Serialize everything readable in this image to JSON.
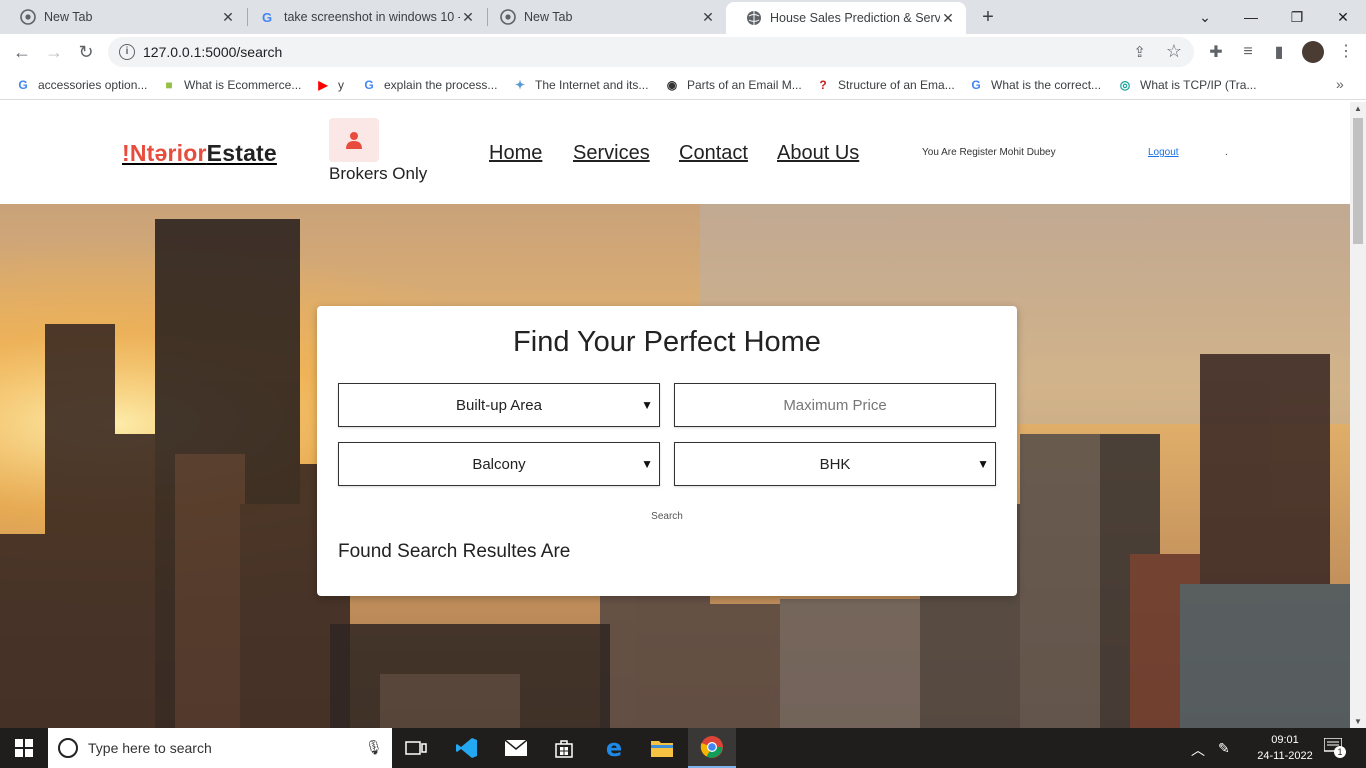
{
  "browser": {
    "tabs": [
      {
        "title": "New Tab"
      },
      {
        "title": "take screenshot in windows 10 -"
      },
      {
        "title": "New Tab"
      },
      {
        "title": "House Sales Prediction & Service"
      }
    ],
    "new_tab": "+",
    "address": "127.0.0.1:5000/search",
    "bookmarks": [
      {
        "label": "accessories option..."
      },
      {
        "label": "What is Ecommerce..."
      },
      {
        "label": "y"
      },
      {
        "label": "explain the process..."
      },
      {
        "label": "The Internet and its..."
      },
      {
        "label": "Parts of an Email M..."
      },
      {
        "label": "Structure of an Ema..."
      },
      {
        "label": "What is the correct..."
      },
      {
        "label": "What is TCP/IP (Tra..."
      }
    ],
    "bookmarks_more": "»"
  },
  "site": {
    "logo_part1": "!Ntərior",
    "logo_part2": "Estate",
    "broker_label": "Brokers Only",
    "nav": [
      "Home",
      "Services",
      "Contact",
      "About Us"
    ],
    "registered_text": "You Are Register Mohit Dubey",
    "logout": "Logout",
    "dot": "."
  },
  "search_card": {
    "title": "Find Your Perfect Home",
    "built_up_area": "Built-up Area",
    "max_price_placeholder": "Maximum Price",
    "balcony": "Balcony",
    "bhk": "BHK",
    "search_label": "Search",
    "results_heading": "Found Search Resultes Are"
  },
  "taskbar": {
    "search_placeholder": "Type here to search",
    "time": "09:01",
    "date": "24-11-2022",
    "notification_count": "1"
  },
  "colors": {
    "logo_accent": "#e84c3d",
    "tab_strip": "#dee1e6",
    "link_blue": "#1a73e8",
    "taskbar": "#201e1c"
  }
}
